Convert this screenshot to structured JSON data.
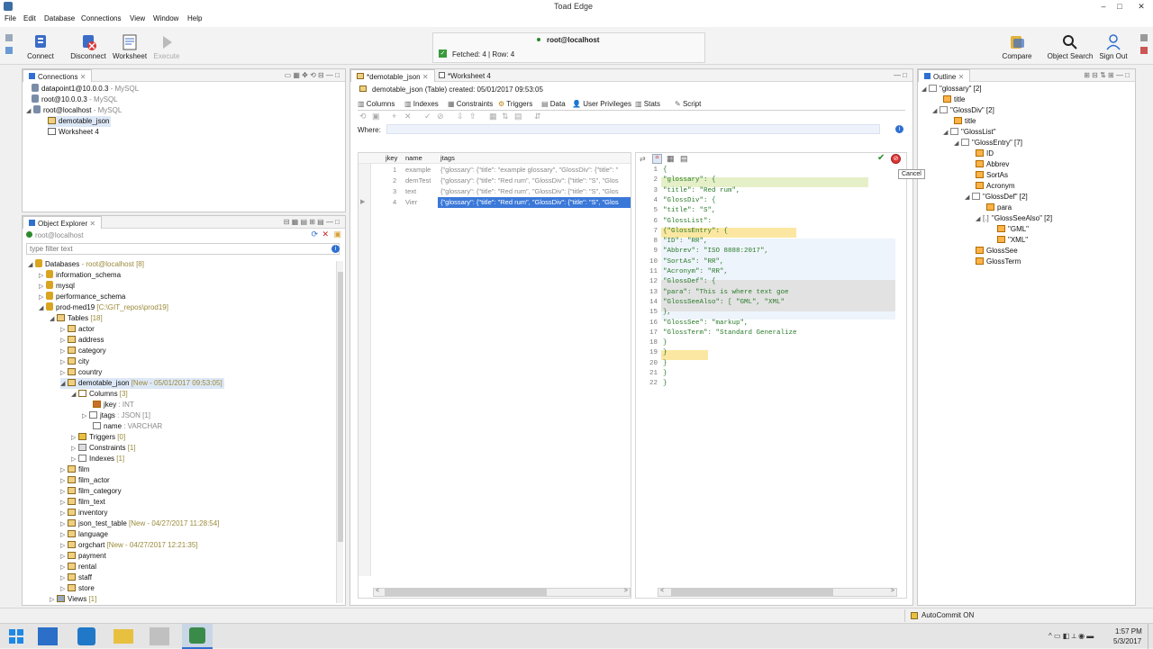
{
  "window": {
    "title": "Toad Edge"
  },
  "menu": [
    "File",
    "Edit",
    "Database",
    "Connections",
    "View",
    "Window",
    "Help"
  ],
  "toolbar": {
    "connect": "Connect",
    "disconnect": "Disconnect",
    "worksheet": "Worksheet",
    "execute": "Execute",
    "compare": "Compare",
    "object_search": "Object Search",
    "sign_out": "Sign Out"
  },
  "status_popup": {
    "connection": "root@localhost",
    "fetched": "Fetched: 4 | Row: 4"
  },
  "connections_panel": {
    "title": "Connections",
    "items": [
      {
        "name": "datapoint1@10.0.0.3",
        "type": " - MySQL"
      },
      {
        "name": "root@10.0.0.3",
        "type": " - MySQL"
      },
      {
        "name": "root@localhost",
        "type": " - MySQL"
      },
      {
        "name": "demotable_json",
        "type": ""
      },
      {
        "name": "Worksheet 4",
        "type": ""
      }
    ]
  },
  "object_explorer": {
    "title": "Object Explorer",
    "connection": "root@localhost",
    "filter_placeholder": "type filter text",
    "databases": "Databases",
    "databases_suffix": " - root@localhost [8]",
    "schemas": [
      "information_schema",
      "mysql",
      "performance_schema"
    ],
    "prod": "prod-med19",
    "prod_path": " [C:\\GIT_repos\\prod19]",
    "tables": "Tables",
    "tables_count": " [18]",
    "t1": [
      "actor",
      "address",
      "category",
      "city",
      "country"
    ],
    "demotable": "demotable_json",
    "demotable_meta": " [New - 05/01/2017 09:53:05]",
    "columns": "Columns",
    "columns_count": " [3]",
    "col_jkey": "jkey",
    "col_jkey_type": " : INT",
    "col_jtags": "jtags",
    "col_jtags_type": " : JSON [1]",
    "col_name": "name",
    "col_name_type": " : VARCHAR",
    "triggers": "Triggers",
    "triggers_count": " [0]",
    "constraints": "Constraints",
    "constraints_count": " [1]",
    "indexes": "Indexes",
    "indexes_count": " [1]",
    "t2": [
      "film",
      "film_actor",
      "film_category",
      "film_text",
      "inventory"
    ],
    "json_test": "json_test_table",
    "json_test_meta": " [New - 04/27/2017 11:28:54]",
    "language": "language",
    "orgchart": "orgchart",
    "orgchart_meta": " [New - 04/27/2017 12:21:35]",
    "t3": [
      "payment",
      "rental",
      "staff",
      "store"
    ],
    "views": "Views",
    "views_count": " [1]"
  },
  "editor": {
    "tab1": "*demotable_json",
    "tab2": "*Worksheet 4",
    "header": "demotable_json (Table) created: 05/01/2017 09:53:05",
    "subtabs": [
      "Columns",
      "Indexes",
      "Constraints",
      "Triggers",
      "Data",
      "User Privileges",
      "Stats",
      "Script"
    ],
    "where_label": "Where:",
    "grid_headers": [
      "jkey",
      "name",
      "jtags"
    ],
    "rows": [
      {
        "n": "1",
        "name": "example",
        "json": "{\"glossary\": {\"title\": \"example glossary\", \"GlossDiv\": {\"title\": \""
      },
      {
        "n": "2",
        "name": "demTest",
        "json": "{\"glossary\": {\"title\": \"Red rum\", \"GlossDiv\": {\"title\": \"S\", \"Glos"
      },
      {
        "n": "3",
        "name": "text",
        "json": "{\"glossary\": {\"title\": \"Red rum\", \"GlossDiv\": {\"title\": \"S\", \"Glos"
      },
      {
        "n": "4",
        "name": "Vier",
        "json": "{\"glossary\": {\"title\": \"Red rum\", \"GlossDiv\": {\"title\": \"S\", \"Glos"
      }
    ],
    "cancel_tooltip": "Cancel",
    "code": [
      "{",
      "    \"glossary\": {",
      "        \"title\": \"Red rum\",",
      "        \"GlossDiv\": {",
      "            \"title\": \"S\",",
      "            \"GlossList\":",
      "                {\"GlossEntry\": {",
      "                    \"ID\": \"RR\",",
      "                    \"Abbrev\": \"ISO 8888:2017\",",
      "                    \"SortAs\": \"RR\",",
      "                    \"Acronym\": \"RR\",",
      "                    \"GlossDef\": {",
      "                        \"para\": \"This is where text goe",
      "                        \"GlossSeeAlso\": [ \"GML\", \"XML\"",
      "                    },",
      "                    \"GlossSee\": \"markup\",",
      "                    \"GlossTerm\": \"Standard Generalize",
      "                }",
      "            }",
      "        }",
      "    }",
      "}"
    ]
  },
  "outline": {
    "title": "Outline",
    "nodes": [
      {
        "label": "\"glossary\" [2]"
      },
      {
        "label": "title"
      },
      {
        "label": "\"GlossDiv\" [2]"
      },
      {
        "label": "title"
      },
      {
        "label": "\"GlossList\""
      },
      {
        "label": "\"GlossEntry\" [7]"
      },
      {
        "label": "ID"
      },
      {
        "label": "Abbrev"
      },
      {
        "label": "SortAs"
      },
      {
        "label": "Acronym"
      },
      {
        "label": "\"GlossDef\" [2]"
      },
      {
        "label": "para"
      },
      {
        "label": "\"GlossSeeAlso\" [2]"
      },
      {
        "label": "\"GML\""
      },
      {
        "label": "\"XML\""
      },
      {
        "label": "GlossSee"
      },
      {
        "label": "GlossTerm"
      }
    ]
  },
  "statusbar": {
    "autocommit": "AutoCommit ON"
  },
  "taskbar": {
    "time": "1:57 PM",
    "date": "5/3/2017"
  },
  "colors": {
    "accent": "#2f6fd1",
    "selection": "#3a78d8",
    "highlight": "#fbe7a1"
  }
}
